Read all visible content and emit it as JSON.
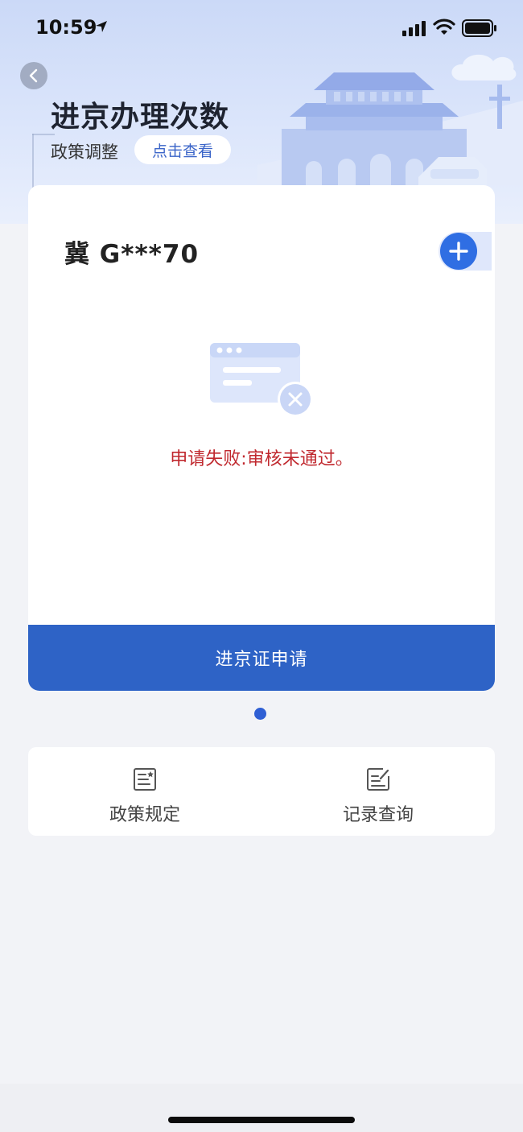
{
  "status_bar": {
    "time": "10:59"
  },
  "header": {
    "title": "进京办理次数",
    "policy_label": "政策调整",
    "view_button": "点击查看"
  },
  "card": {
    "plate_number": "冀 G***70",
    "status_message": "申请失败:审核未通过。",
    "apply_button": "进京证申请"
  },
  "carousel": {
    "current_page": 1,
    "total_pages": 1
  },
  "menu": {
    "items": [
      {
        "label": "政策规定",
        "icon": "policy-document-icon"
      },
      {
        "label": "记录查询",
        "icon": "record-edit-icon"
      }
    ]
  },
  "colors": {
    "accent": "#2e63c6",
    "error": "#c0282e",
    "header_bg": "#cbd9f7"
  }
}
